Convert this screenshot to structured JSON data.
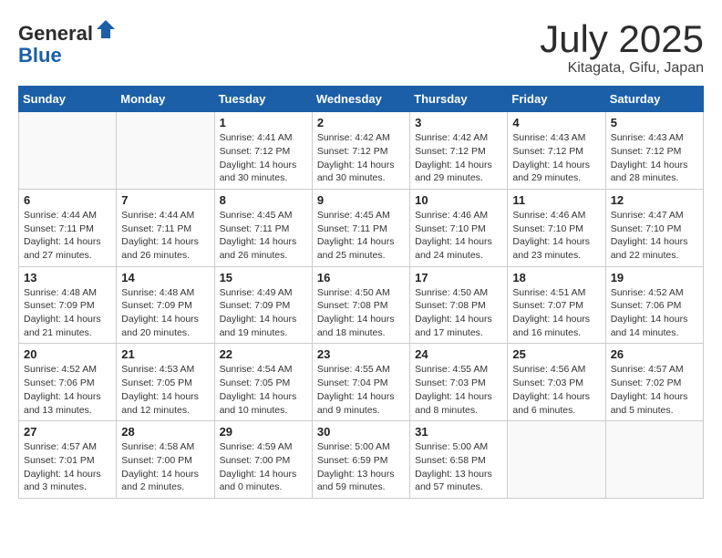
{
  "header": {
    "logo_general": "General",
    "logo_blue": "Blue",
    "month_title": "July 2025",
    "location": "Kitagata, Gifu, Japan"
  },
  "weekdays": [
    "Sunday",
    "Monday",
    "Tuesday",
    "Wednesday",
    "Thursday",
    "Friday",
    "Saturday"
  ],
  "weeks": [
    [
      {
        "day": "",
        "sunrise": "",
        "sunset": "",
        "daylight": "",
        "empty": true
      },
      {
        "day": "",
        "sunrise": "",
        "sunset": "",
        "daylight": "",
        "empty": true
      },
      {
        "day": "1",
        "sunrise": "Sunrise: 4:41 AM",
        "sunset": "Sunset: 7:12 PM",
        "daylight": "Daylight: 14 hours and 30 minutes."
      },
      {
        "day": "2",
        "sunrise": "Sunrise: 4:42 AM",
        "sunset": "Sunset: 7:12 PM",
        "daylight": "Daylight: 14 hours and 30 minutes."
      },
      {
        "day": "3",
        "sunrise": "Sunrise: 4:42 AM",
        "sunset": "Sunset: 7:12 PM",
        "daylight": "Daylight: 14 hours and 29 minutes."
      },
      {
        "day": "4",
        "sunrise": "Sunrise: 4:43 AM",
        "sunset": "Sunset: 7:12 PM",
        "daylight": "Daylight: 14 hours and 29 minutes."
      },
      {
        "day": "5",
        "sunrise": "Sunrise: 4:43 AM",
        "sunset": "Sunset: 7:12 PM",
        "daylight": "Daylight: 14 hours and 28 minutes."
      }
    ],
    [
      {
        "day": "6",
        "sunrise": "Sunrise: 4:44 AM",
        "sunset": "Sunset: 7:11 PM",
        "daylight": "Daylight: 14 hours and 27 minutes."
      },
      {
        "day": "7",
        "sunrise": "Sunrise: 4:44 AM",
        "sunset": "Sunset: 7:11 PM",
        "daylight": "Daylight: 14 hours and 26 minutes."
      },
      {
        "day": "8",
        "sunrise": "Sunrise: 4:45 AM",
        "sunset": "Sunset: 7:11 PM",
        "daylight": "Daylight: 14 hours and 26 minutes."
      },
      {
        "day": "9",
        "sunrise": "Sunrise: 4:45 AM",
        "sunset": "Sunset: 7:11 PM",
        "daylight": "Daylight: 14 hours and 25 minutes."
      },
      {
        "day": "10",
        "sunrise": "Sunrise: 4:46 AM",
        "sunset": "Sunset: 7:10 PM",
        "daylight": "Daylight: 14 hours and 24 minutes."
      },
      {
        "day": "11",
        "sunrise": "Sunrise: 4:46 AM",
        "sunset": "Sunset: 7:10 PM",
        "daylight": "Daylight: 14 hours and 23 minutes."
      },
      {
        "day": "12",
        "sunrise": "Sunrise: 4:47 AM",
        "sunset": "Sunset: 7:10 PM",
        "daylight": "Daylight: 14 hours and 22 minutes."
      }
    ],
    [
      {
        "day": "13",
        "sunrise": "Sunrise: 4:48 AM",
        "sunset": "Sunset: 7:09 PM",
        "daylight": "Daylight: 14 hours and 21 minutes."
      },
      {
        "day": "14",
        "sunrise": "Sunrise: 4:48 AM",
        "sunset": "Sunset: 7:09 PM",
        "daylight": "Daylight: 14 hours and 20 minutes."
      },
      {
        "day": "15",
        "sunrise": "Sunrise: 4:49 AM",
        "sunset": "Sunset: 7:09 PM",
        "daylight": "Daylight: 14 hours and 19 minutes."
      },
      {
        "day": "16",
        "sunrise": "Sunrise: 4:50 AM",
        "sunset": "Sunset: 7:08 PM",
        "daylight": "Daylight: 14 hours and 18 minutes."
      },
      {
        "day": "17",
        "sunrise": "Sunrise: 4:50 AM",
        "sunset": "Sunset: 7:08 PM",
        "daylight": "Daylight: 14 hours and 17 minutes."
      },
      {
        "day": "18",
        "sunrise": "Sunrise: 4:51 AM",
        "sunset": "Sunset: 7:07 PM",
        "daylight": "Daylight: 14 hours and 16 minutes."
      },
      {
        "day": "19",
        "sunrise": "Sunrise: 4:52 AM",
        "sunset": "Sunset: 7:06 PM",
        "daylight": "Daylight: 14 hours and 14 minutes."
      }
    ],
    [
      {
        "day": "20",
        "sunrise": "Sunrise: 4:52 AM",
        "sunset": "Sunset: 7:06 PM",
        "daylight": "Daylight: 14 hours and 13 minutes."
      },
      {
        "day": "21",
        "sunrise": "Sunrise: 4:53 AM",
        "sunset": "Sunset: 7:05 PM",
        "daylight": "Daylight: 14 hours and 12 minutes."
      },
      {
        "day": "22",
        "sunrise": "Sunrise: 4:54 AM",
        "sunset": "Sunset: 7:05 PM",
        "daylight": "Daylight: 14 hours and 10 minutes."
      },
      {
        "day": "23",
        "sunrise": "Sunrise: 4:55 AM",
        "sunset": "Sunset: 7:04 PM",
        "daylight": "Daylight: 14 hours and 9 minutes."
      },
      {
        "day": "24",
        "sunrise": "Sunrise: 4:55 AM",
        "sunset": "Sunset: 7:03 PM",
        "daylight": "Daylight: 14 hours and 8 minutes."
      },
      {
        "day": "25",
        "sunrise": "Sunrise: 4:56 AM",
        "sunset": "Sunset: 7:03 PM",
        "daylight": "Daylight: 14 hours and 6 minutes."
      },
      {
        "day": "26",
        "sunrise": "Sunrise: 4:57 AM",
        "sunset": "Sunset: 7:02 PM",
        "daylight": "Daylight: 14 hours and 5 minutes."
      }
    ],
    [
      {
        "day": "27",
        "sunrise": "Sunrise: 4:57 AM",
        "sunset": "Sunset: 7:01 PM",
        "daylight": "Daylight: 14 hours and 3 minutes."
      },
      {
        "day": "28",
        "sunrise": "Sunrise: 4:58 AM",
        "sunset": "Sunset: 7:00 PM",
        "daylight": "Daylight: 14 hours and 2 minutes."
      },
      {
        "day": "29",
        "sunrise": "Sunrise: 4:59 AM",
        "sunset": "Sunset: 7:00 PM",
        "daylight": "Daylight: 14 hours and 0 minutes."
      },
      {
        "day": "30",
        "sunrise": "Sunrise: 5:00 AM",
        "sunset": "Sunset: 6:59 PM",
        "daylight": "Daylight: 13 hours and 59 minutes."
      },
      {
        "day": "31",
        "sunrise": "Sunrise: 5:00 AM",
        "sunset": "Sunset: 6:58 PM",
        "daylight": "Daylight: 13 hours and 57 minutes."
      },
      {
        "day": "",
        "sunrise": "",
        "sunset": "",
        "daylight": "",
        "empty": true
      },
      {
        "day": "",
        "sunrise": "",
        "sunset": "",
        "daylight": "",
        "empty": true
      }
    ]
  ]
}
